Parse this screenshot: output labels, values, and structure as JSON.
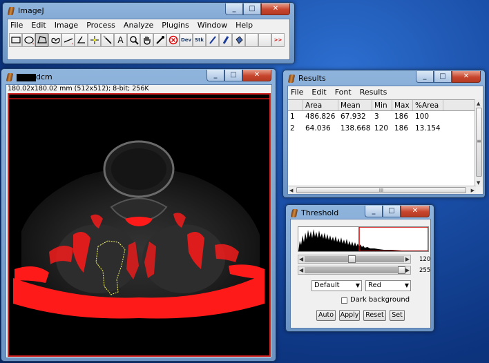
{
  "imagej": {
    "title": "ImageJ",
    "menus": [
      "File",
      "Edit",
      "Image",
      "Process",
      "Analyze",
      "Plugins",
      "Window",
      "Help"
    ],
    "tools": [
      {
        "name": "rectangle-tool-icon"
      },
      {
        "name": "oval-tool-icon"
      },
      {
        "name": "polygon-tool-icon"
      },
      {
        "name": "freehand-tool-icon"
      },
      {
        "name": "line-tool-icon"
      },
      {
        "name": "angle-tool-icon"
      },
      {
        "name": "point-tool-icon"
      },
      {
        "name": "wand-tool-icon"
      },
      {
        "name": "text-tool-icon",
        "glyph": "A"
      },
      {
        "name": "magnifier-tool-icon"
      },
      {
        "name": "hand-tool-icon"
      },
      {
        "name": "color-picker-icon"
      },
      {
        "name": "stop-tool-icon"
      },
      {
        "name": "dev-tool-icon",
        "glyph": "Dev"
      },
      {
        "name": "stk-tool-icon",
        "glyph": "Stk"
      },
      {
        "name": "pencil-tool-icon"
      },
      {
        "name": "brush-tool-icon"
      },
      {
        "name": "flood-fill-icon"
      },
      {
        "name": "empty-tool-slot"
      },
      {
        "name": "empty-tool-slot"
      },
      {
        "name": "more-tools-icon",
        "glyph": ">>"
      }
    ]
  },
  "image_window": {
    "title_suffix": "dcm",
    "info": "180.02x180.02 mm (512x512); 8-bit; 256K"
  },
  "results": {
    "title": "Results",
    "menus": [
      "File",
      "Edit",
      "Font",
      "Results"
    ],
    "columns": [
      "",
      "Area",
      "Mean",
      "Min",
      "Max",
      "%Area"
    ],
    "rows": [
      [
        "1",
        "486.826",
        "67.932",
        "3",
        "186",
        "100"
      ],
      [
        "2",
        "64.036",
        "138.668",
        "120",
        "186",
        "13.154"
      ]
    ],
    "hscroll_grip": "III",
    "vscroll_grip": "≡"
  },
  "threshold": {
    "title": "Threshold",
    "lower_value": "120",
    "upper_value": "255",
    "lower_level": 0.47,
    "upper_level": 1.0,
    "method": "Default",
    "display_mode": "Red",
    "dark_background_label": "Dark background",
    "dark_background_checked": false,
    "buttons": {
      "auto": "Auto",
      "apply": "Apply",
      "reset": "Reset",
      "set": "Set"
    }
  },
  "caption_buttons": {
    "minimize": "_",
    "maximize": "□",
    "close": "✕"
  },
  "colors": {
    "threshold_overlay": "#ff1a1a",
    "selection_outline": "#ffff66"
  }
}
